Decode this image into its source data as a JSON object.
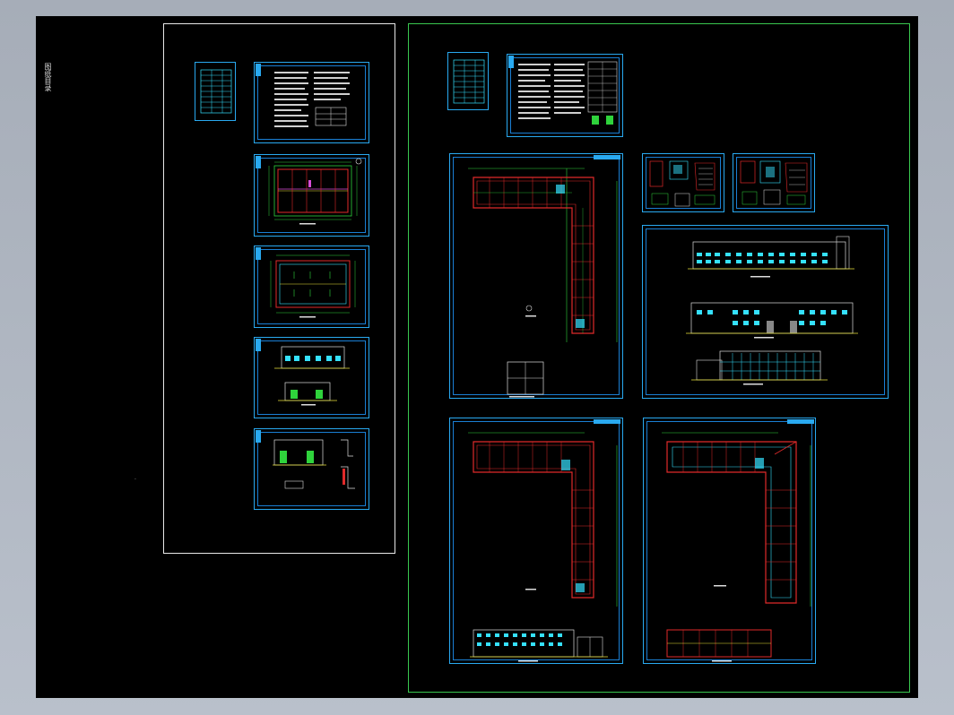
{
  "app": {
    "side_label": "图纸目录",
    "dot_text": "·",
    "colors": {
      "canvas": "#000000",
      "frame_cyan": "#29a9f0",
      "frame_green": "#39c84f",
      "frame_white": "#e8e8e8",
      "line_red": "#e02a2a",
      "line_green": "#2fd33c",
      "line_cyan": "#35e1ff",
      "line_yellow": "#e8e23a",
      "line_magenta": "#d84cd8"
    }
  },
  "left_group": {
    "sheets": [
      {
        "name": "index-table-sheet"
      },
      {
        "name": "design-notes-sheet"
      },
      {
        "name": "first-floor-plan-sheet"
      },
      {
        "name": "roof-plan-sheet"
      },
      {
        "name": "elevation-section-sheet"
      },
      {
        "name": "detail-sheet"
      }
    ]
  },
  "right_group": {
    "sheets": [
      {
        "name": "index-table-sheet-2"
      },
      {
        "name": "design-notes-sheet-2"
      },
      {
        "name": "l-shaped-first-floor-plan-sheet"
      },
      {
        "name": "stair-detail-sheet-a"
      },
      {
        "name": "stair-detail-sheet-b"
      },
      {
        "name": "elevations-sheet"
      },
      {
        "name": "l-shaped-second-floor-plan-sheet"
      },
      {
        "name": "l-shaped-roof-plan-sheet"
      }
    ]
  }
}
